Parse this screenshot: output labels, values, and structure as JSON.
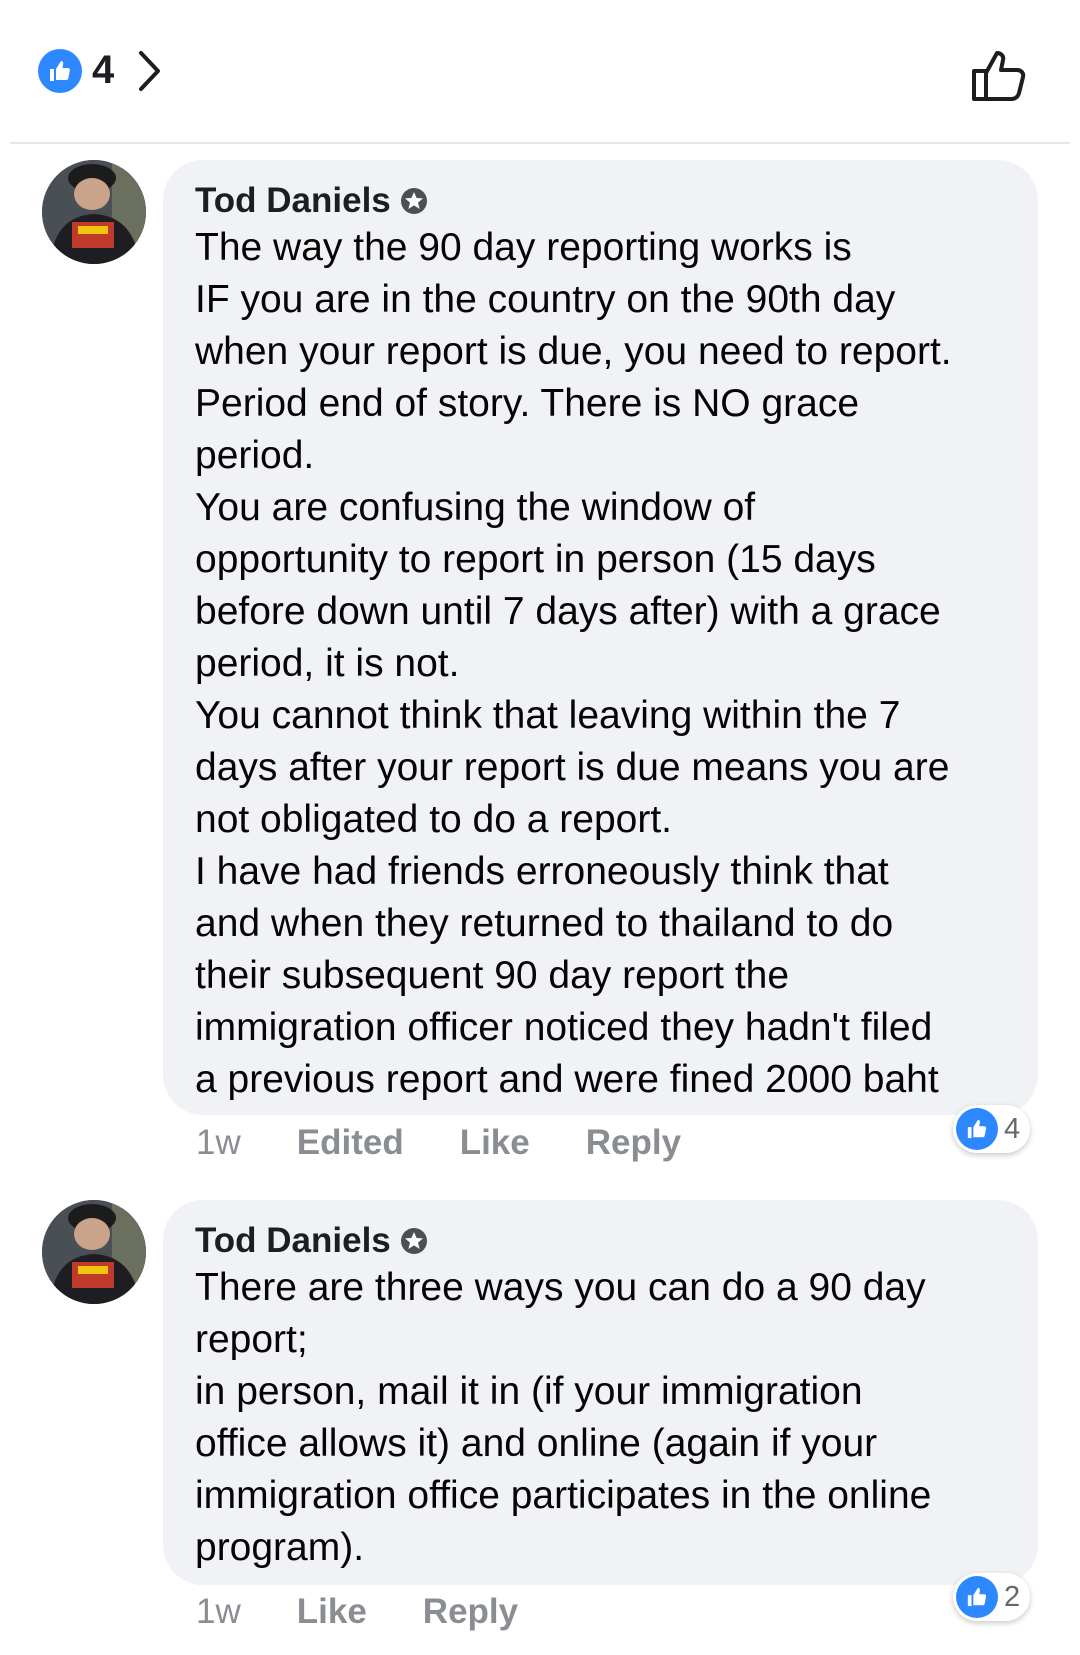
{
  "header": {
    "reaction_count": "4"
  },
  "comments": [
    {
      "author": "Tod Daniels",
      "text": "The way the 90 day reporting works is\nIF you are in the country on the 90th day\nwhen your report is due, you need to report.\nPeriod end of story. There is NO grace\nperiod.\nYou are confusing the window of\nopportunity to report in person (15 days\nbefore down until 7 days after) with a grace\nperiod, it is not.\nYou cannot think that leaving within the 7\ndays after your report is due means you are\nnot obligated to do a report.\nI have had friends erroneously think that\nand when they returned to thailand to do\ntheir subsequent 90 day report the\nimmigration officer noticed they hadn't filed\na previous report and were fined 2000 baht",
      "time": "1w",
      "edited_label": "Edited",
      "like_label": "Like",
      "reply_label": "Reply",
      "reaction_count": "4"
    },
    {
      "author": "Tod Daniels",
      "text": "There are three ways you can do a 90 day\nreport;\nin person, mail it in (if your immigration\noffice allows it) and online (again if your\nimmigration office participates in the online\nprogram).",
      "time": "1w",
      "like_label": "Like",
      "reply_label": "Reply",
      "reaction_count": "2"
    }
  ],
  "colors": {
    "accent": "#2d88ff",
    "bubble": "#f0f2f5",
    "meta_text": "#8a8d91"
  },
  "icons": [
    "like-badge-icon",
    "chevron-right-icon",
    "thumbs-up-outline-icon",
    "top-fan-badge-icon"
  ]
}
